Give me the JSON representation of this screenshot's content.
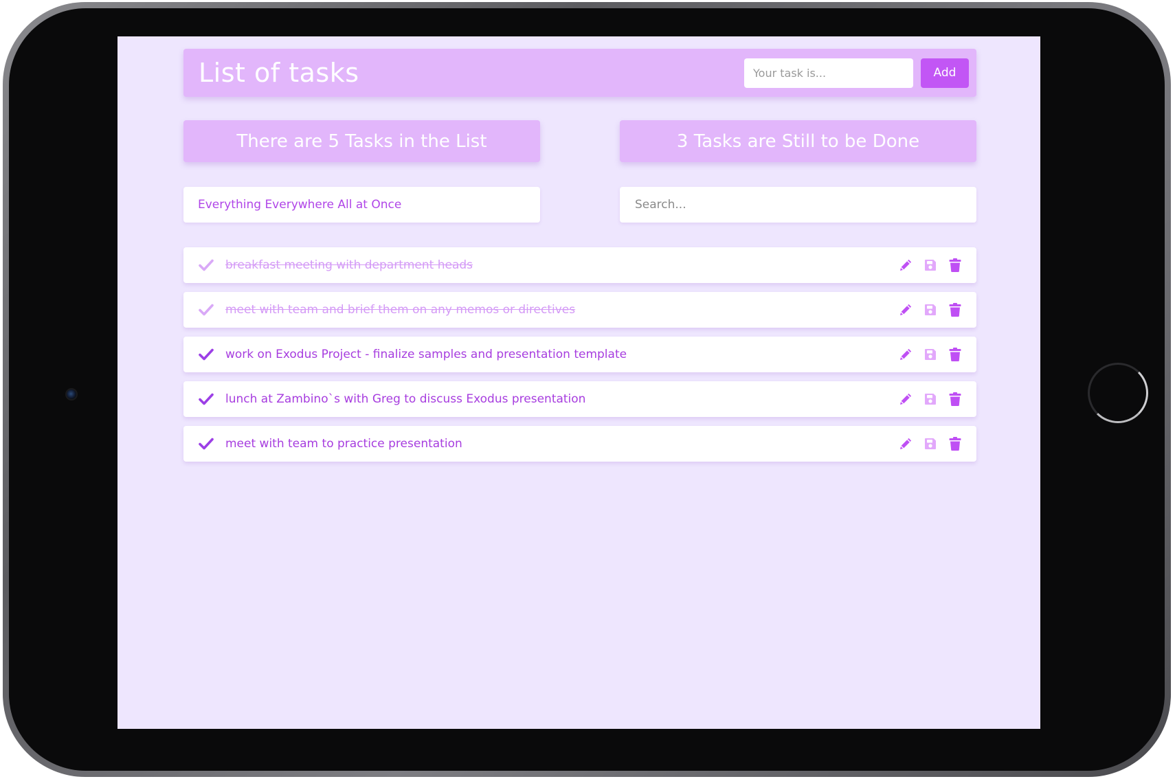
{
  "app": {
    "title": "List of tasks",
    "new_task_placeholder": "Your task is...",
    "add_label": "Add"
  },
  "stats": {
    "total_label": "There are 5 Tasks in the List",
    "remaining_label": "3 Tasks are Still to be Done"
  },
  "filter": {
    "selected": "Everything Everywhere All at Once",
    "search_placeholder": "Search..."
  },
  "colors": {
    "accent": "#c256f5",
    "header_bg": "#e2b6fb",
    "page_bg": "#eee6fe",
    "task_text": "#a73ddf",
    "done_text": "#d49af6"
  },
  "tasks": [
    {
      "text": "breakfast meeting with department heads",
      "done": true
    },
    {
      "text": "meet with team and brief them on any memos or directives",
      "done": true
    },
    {
      "text": "work on Exodus Project - finalize samples and presentation template",
      "done": false
    },
    {
      "text": "lunch at Zambino`s with Greg to discuss Exodus presentation",
      "done": false
    },
    {
      "text": "meet with team to practice presentation",
      "done": false
    }
  ],
  "icons": {
    "check": "check-icon",
    "edit": "pencil-icon",
    "save": "floppy-disk-icon",
    "delete": "trash-icon"
  }
}
